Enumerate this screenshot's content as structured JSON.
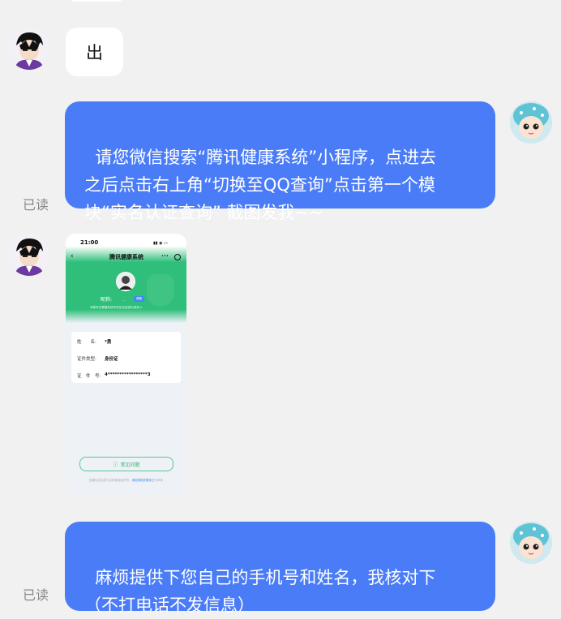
{
  "messages": {
    "m1": {
      "text": "出"
    },
    "m2": {
      "text": "请您微信搜索“腾讯健康系统”小程序，点进去\n之后点击右上角“切换至QQ查询”点击第一个模\n块“实名认证查询” 截图发我~~",
      "status": "已读"
    },
    "m3": {
      "screenshot": {
        "time": "21:00",
        "title": "腾讯健康系统",
        "menu_dots": "•••",
        "nickname_label": "昵称:",
        "nickname_value": ".",
        "badge": "健康",
        "subtitle": "本账号在健康系统中的实名信息为成年人",
        "rows": [
          {
            "k": "姓　　名:",
            "v": "*勇"
          },
          {
            "k": "证件类型:",
            "v": "身份证"
          },
          {
            "k": "证　件　号:",
            "v": "4*****************3"
          }
        ],
        "button": "常见问题",
        "footer_prefix": "如果实名信息与实际使用者不符，",
        "footer_link": "请使用相关服务",
        "footer_suffix": "进行申诉"
      }
    },
    "m4": {
      "text": "麻烦提供下您自己的手机号和姓名，我核对下\n（不打电话不发信息）",
      "status": "已读"
    }
  },
  "colors": {
    "accent_blue": "#4a7cf7",
    "green": "#2bb673",
    "bg": "#f1f1f1"
  },
  "icons": [
    "user-avatar-anime",
    "agent-avatar-baby-hat",
    "back-arrow-icon",
    "record-icon",
    "question-icon"
  ]
}
